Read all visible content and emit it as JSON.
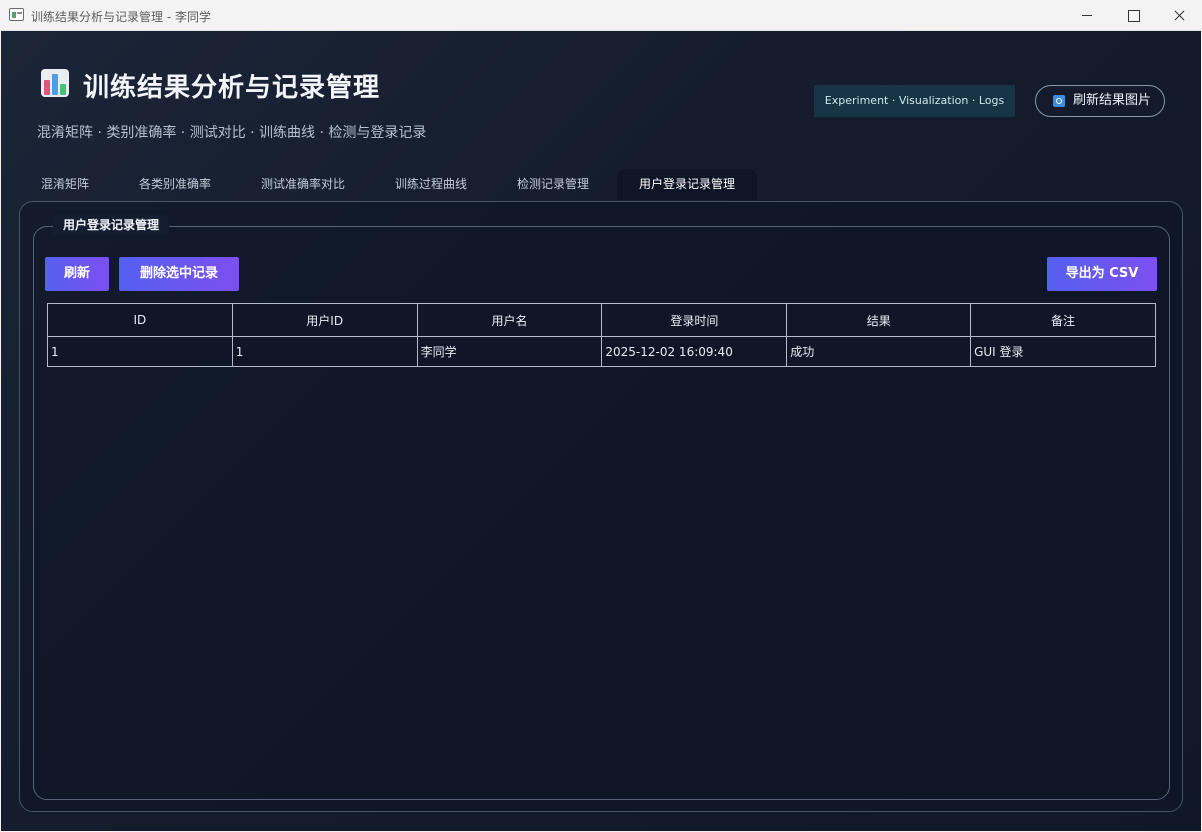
{
  "window": {
    "title": "训练结果分析与记录管理 - 李同学"
  },
  "header": {
    "icon": "bar-chart-icon",
    "title": "训练结果分析与记录管理",
    "subtitle": "混淆矩阵 · 类别准确率 · 测试对比 · 训练曲线 · 检测与登录记录",
    "badge": "Experiment · Visualization · Logs",
    "refresh_images_label": "刷新结果图片"
  },
  "tabs": [
    {
      "label": "混淆矩阵",
      "active": false
    },
    {
      "label": "各类别准确率",
      "active": false
    },
    {
      "label": "测试准确率对比",
      "active": false
    },
    {
      "label": "训练过程曲线",
      "active": false
    },
    {
      "label": "检测记录管理",
      "active": false
    },
    {
      "label": "用户登录记录管理",
      "active": true
    }
  ],
  "panel": {
    "group_title": "用户登录记录管理",
    "buttons": {
      "refresh": "刷新",
      "delete_selected": "删除选中记录",
      "export_csv": "导出为 CSV"
    },
    "table": {
      "columns": [
        "ID",
        "用户ID",
        "用户名",
        "登录时间",
        "结果",
        "备注"
      ],
      "rows": [
        [
          "1",
          "1",
          "李同学",
          "2025-12-02 16:09:40",
          "成功",
          "GUI 登录"
        ]
      ]
    }
  },
  "colors": {
    "accent_start": "#5560f0",
    "accent_end": "#7d4ff0",
    "background": "#141c2d",
    "badge_bg": "#173444"
  }
}
